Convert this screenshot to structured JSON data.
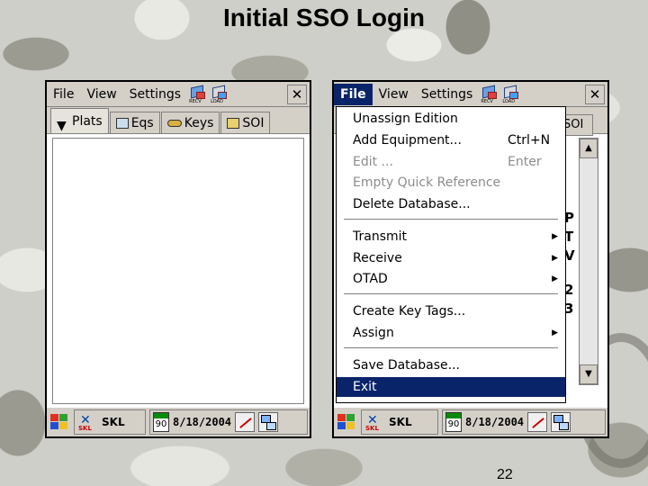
{
  "slide": {
    "title": "Initial SSO Login",
    "page_number": "22"
  },
  "left_window": {
    "menu": [
      "File",
      "View",
      "Settings"
    ],
    "toolbar_icons": [
      "recv-icon",
      "load-icon"
    ],
    "tool_captions": [
      "RECV",
      "LOAD"
    ],
    "close_label": "✕",
    "tabs": [
      "Plats",
      "Eqs",
      "Keys",
      "SOI"
    ],
    "taskbar": {
      "app_label": "SKL",
      "logo_text": "SKL",
      "calendar_number": "90",
      "date": "8/18/2004"
    }
  },
  "right_window": {
    "menu": [
      "File",
      "View",
      "Settings"
    ],
    "active_menu": "File",
    "tool_captions": [
      "RECV",
      "LOAD"
    ],
    "close_label": "✕",
    "visible_tab": "SOI",
    "peek_letters": [
      "P",
      "T",
      "V",
      "2",
      "3"
    ],
    "scroll_up": "▲",
    "scroll_down": "▼",
    "dropdown": [
      {
        "label": "Unassign Edition",
        "shortcut": "",
        "disabled": false
      },
      {
        "label": "Add Equipment...",
        "shortcut": "Ctrl+N",
        "disabled": false
      },
      {
        "label": "Edit ...",
        "shortcut": "Enter",
        "disabled": true
      },
      {
        "label": "Empty Quick Reference",
        "shortcut": "",
        "disabled": true
      },
      {
        "label": "Delete Database...",
        "shortcut": "",
        "disabled": false
      },
      {
        "label": "Transmit",
        "submenu": true
      },
      {
        "label": "Receive",
        "submenu": true
      },
      {
        "label": "OTAD",
        "submenu": true
      },
      {
        "label": "Create Key Tags...",
        "shortcut": ""
      },
      {
        "label": "Assign",
        "submenu": true
      },
      {
        "label": "Save Database...",
        "shortcut": ""
      },
      {
        "label": "Exit",
        "shortcut": "",
        "highlighted": true
      }
    ],
    "submenu_arrow": "▶",
    "taskbar": {
      "app_label": "SKL",
      "logo_text": "SKL",
      "calendar_number": "90",
      "date": "8/18/2004"
    }
  },
  "colors": {
    "menu_highlight": "#0a246a",
    "chrome": "#d4d0c8",
    "disabled_text": "#8c8c8c"
  }
}
